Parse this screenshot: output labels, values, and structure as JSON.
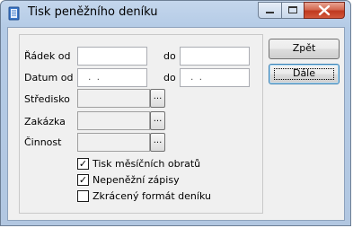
{
  "window": {
    "title": "Tisk peněžního deníku",
    "controls": [
      "minimize",
      "maximize",
      "close"
    ]
  },
  "form": {
    "radek_od_label": "Řádek od",
    "radek_do_label": "do",
    "radek_od_value": "",
    "radek_do_value": "",
    "datum_od_label": "Datum od",
    "datum_do_label": "do",
    "datum_od_value": " .  .",
    "datum_do_value": " .  .",
    "stredisko_label": "Středisko",
    "zakazka_label": "Zakázka",
    "cinnost_label": "Činnost",
    "ellipsis": "..."
  },
  "checkboxes": [
    {
      "label": "Tisk měsíčních obratů",
      "checked": true
    },
    {
      "label": "Nepeněžní zápisy",
      "checked": true
    },
    {
      "label": "Zkrácený formát deníku",
      "checked": false
    }
  ],
  "buttons": {
    "back": "Zpět",
    "next": "Dále"
  },
  "icons": {
    "app": "journal-app-icon",
    "minimize": "minimize-icon",
    "maximize": "maximize-icon",
    "close": "close-icon"
  }
}
